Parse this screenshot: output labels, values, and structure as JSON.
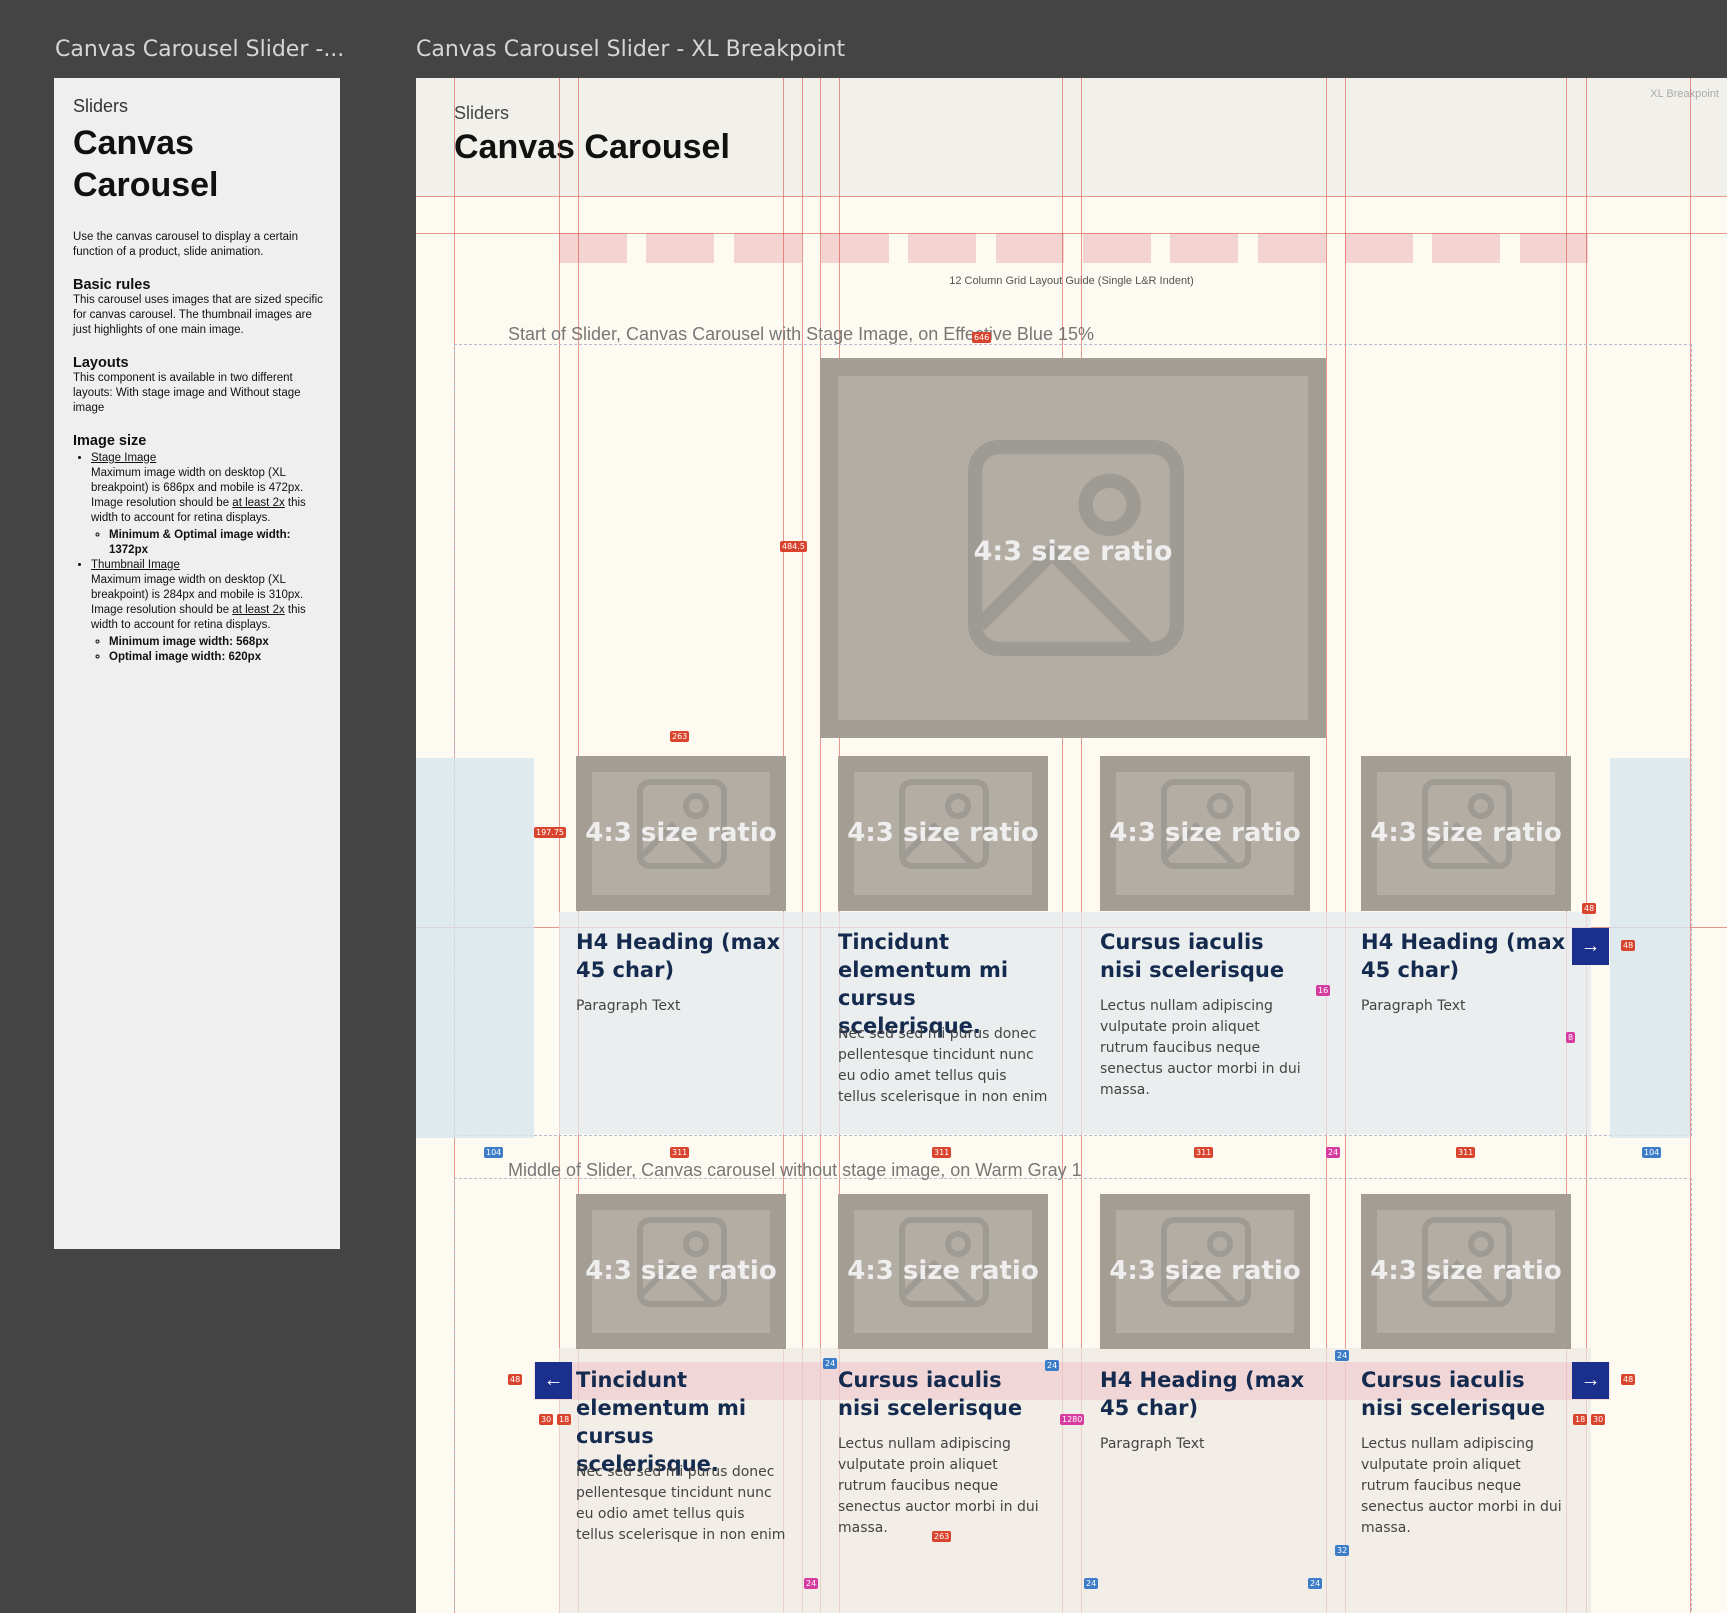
{
  "frames": {
    "left_title": "Canvas Carousel Slider -...",
    "right_title": "Canvas Carousel Slider - XL Breakpoint"
  },
  "doc": {
    "eyebrow": "Sliders",
    "title": "Canvas Carousel",
    "intro": "Use the canvas carousel to display a certain function of a product, slide animation.",
    "basic_rules_heading": "Basic rules",
    "basic_rules_text": "This carousel uses images that are sized specific for canvas carousel. The thumbnail images are just highlights of one main image.",
    "layouts_heading": "Layouts",
    "layouts_text": "This component is available in two different layouts: With stage image and Without stage image",
    "image_size_heading": "Image size",
    "stage_image_link": "Stage Image",
    "stage_image_text_a": "Maximum image width on desktop (XL breakpoint) is 686px and mobile is 472px. Image resolution should be ",
    "stage_image_underline": "at least 2x",
    "stage_image_text_b": " this width to account for retina displays.",
    "stage_image_min": "Minimum & Optimal image width: 1372px",
    "thumb_image_link": "Thumbnail Image",
    "thumb_image_text_a": "Maximum image width on desktop (XL breakpoint) is 284px and mobile is 310px. Image resolution should be ",
    "thumb_image_underline": "at least 2x",
    "thumb_image_text_b": " this width to account for retina displays.",
    "thumb_min": "Minimum image width: 568px",
    "thumb_optimal": "Optimal image width: 620px"
  },
  "canvas": {
    "breakpoint_label": "XL Breakpoint",
    "eyebrow": "Sliders",
    "title": "Canvas Carousel",
    "grid_label": "12 Column Grid Layout Guide (Single L&R Indent)",
    "caption_start": "Start of Slider, Canvas Carousel with Stage Image, on Effective Blue 15%",
    "caption_middle": "Middle of Slider, Canvas carousel without stage image, on Warm Gray 1",
    "stage_label": "4:3 size ratio",
    "row1": [
      {
        "img": "4:3 size ratio",
        "heading": "H4 Heading (max 45 char)",
        "para": "Paragraph Text"
      },
      {
        "img": "4:3 size ratio",
        "heading": "Tincidunt elementum mi cursus scelerisque.",
        "para": "Nec sed sed mi purus donec pellentesque tincidunt nunc eu odio amet tellus quis tellus scelerisque in non enim"
      },
      {
        "img": "4:3 size ratio",
        "heading": "Cursus iaculis nisi scelerisque",
        "para": "Lectus nullam adipiscing vulputate proin aliquet rutrum faucibus neque senectus auctor morbi in dui massa."
      },
      {
        "img": "4:3 size ratio",
        "heading": "H4 Heading (max 45 char)",
        "para": "Paragraph Text"
      }
    ],
    "row2": [
      {
        "img": "4:3 size ratio",
        "heading": "Tincidunt elementum mi cursus scelerisque.",
        "para": "Nec sed sed mi purus donec pellentesque tincidunt nunc eu odio amet tellus quis tellus scelerisque in non enim"
      },
      {
        "img": "4:3 size ratio",
        "heading": "Cursus iaculis nisi scelerisque",
        "para": "Lectus nullam adipiscing vulputate proin aliquet rutrum faucibus neque senectus auctor morbi in dui massa."
      },
      {
        "img": "4:3 size ratio",
        "heading": "H4 Heading (max 45 char)",
        "para": "Paragraph Text"
      },
      {
        "img": "4:3 size ratio",
        "heading": "Cursus iaculis nisi scelerisque",
        "para": "Lectus nullam adipiscing vulputate proin aliquet rutrum faucibus neque senectus auctor morbi in dui massa."
      }
    ],
    "nav": {
      "next_icon": "arrow-right-icon",
      "prev_icon": "arrow-left-icon",
      "next": "→",
      "prev": "←"
    },
    "redlines": {
      "stage_height": "484.5",
      "stage_offset": "646",
      "thumb_width": "263",
      "thumb_height": "197.75",
      "card_width": "311",
      "gutter": "24",
      "side": "104",
      "btn": "48",
      "gap16": "16",
      "gap8": "8",
      "gap30": "30",
      "gap18": "18",
      "total": "1280",
      "gap32": "32"
    },
    "colors": {
      "grid_line": "#d7463c",
      "nav_button": "#1b2f8c",
      "placeholder": "#a39d94",
      "heading": "#142a4e"
    }
  }
}
